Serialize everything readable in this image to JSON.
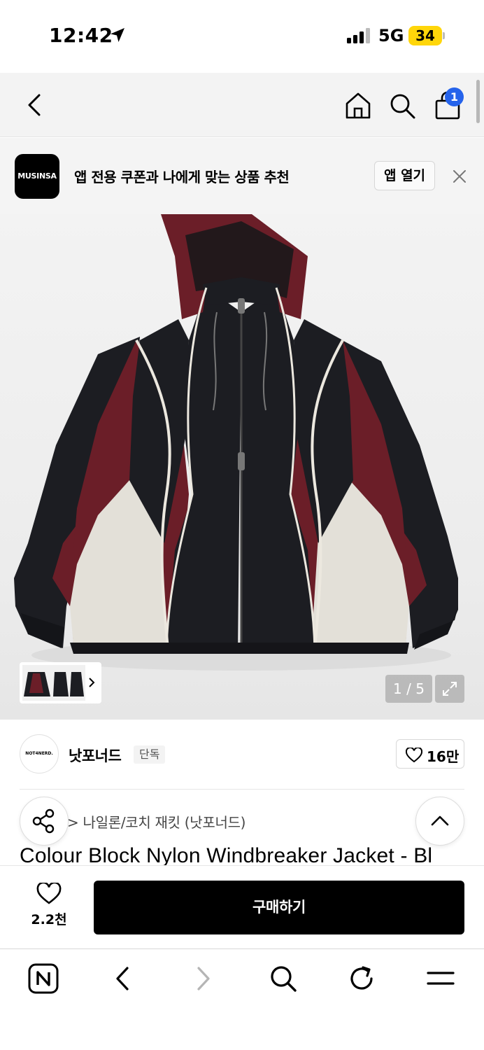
{
  "status_bar": {
    "time": "12:42",
    "network": "5G",
    "battery": "34"
  },
  "header": {
    "cart_count": "1"
  },
  "app_banner": {
    "logo_text": "MUSINSA",
    "message": "앱 전용 쿠폰과 나에게 맞는 상품 추천",
    "open_label": "앱 열기"
  },
  "gallery": {
    "page_indicator": "1 / 5",
    "current_index": 1,
    "total": 5
  },
  "brand": {
    "logo_text": "NOT4NERD.",
    "name": "낫포너드",
    "tag": "단독",
    "likes": "16만"
  },
  "product": {
    "category": "> 나일론/코치 재킷 (낫포너드)",
    "title": "Colour Block Nylon Windbreaker Jacket - Bl"
  },
  "purchase": {
    "wish_count": "2.2천",
    "buy_label": "구매하기"
  },
  "colors": {
    "accent_badge": "#2563eb",
    "battery": "#ffd60a",
    "buy_button": "#000000",
    "jacket_black": "#1c1d22",
    "jacket_burgundy": "#6b1e28",
    "jacket_cream": "#e3e0d8"
  },
  "icons": {
    "header": [
      "back-icon",
      "home-icon",
      "search-icon",
      "bag-icon"
    ],
    "toolbar": [
      "naver-icon",
      "back-icon",
      "forward-icon",
      "search-icon",
      "reload-icon",
      "menu-icon"
    ]
  }
}
